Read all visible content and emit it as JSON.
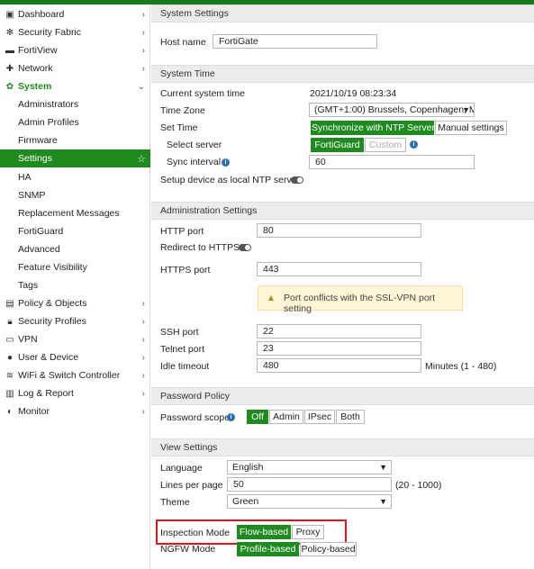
{
  "sidebar": {
    "items": [
      {
        "label": "Dashboard",
        "icon": "dashboard-icon"
      },
      {
        "label": "Security Fabric",
        "icon": "security-fabric-icon"
      },
      {
        "label": "FortiView",
        "icon": "fortiview-icon"
      },
      {
        "label": "Network",
        "icon": "network-icon"
      },
      {
        "label": "System",
        "icon": "gear-icon"
      },
      {
        "label": "Administrators"
      },
      {
        "label": "Admin Profiles"
      },
      {
        "label": "Firmware"
      },
      {
        "label": "Settings"
      },
      {
        "label": "HA"
      },
      {
        "label": "SNMP"
      },
      {
        "label": "Replacement Messages"
      },
      {
        "label": "FortiGuard"
      },
      {
        "label": "Advanced"
      },
      {
        "label": "Feature Visibility"
      },
      {
        "label": "Tags"
      },
      {
        "label": "Policy & Objects",
        "icon": "policy-icon"
      },
      {
        "label": "Security Profiles",
        "icon": "lock-icon"
      },
      {
        "label": "VPN",
        "icon": "vpn-icon"
      },
      {
        "label": "User & Device",
        "icon": "user-icon"
      },
      {
        "label": "WiFi & Switch Controller",
        "icon": "wifi-icon"
      },
      {
        "label": "Log & Report",
        "icon": "chart-icon"
      },
      {
        "label": "Monitor",
        "icon": "monitor-icon"
      }
    ]
  },
  "system_settings": {
    "header": "System Settings",
    "hostname_label": "Host name",
    "hostname_value": "FortiGate"
  },
  "system_time": {
    "header": "System Time",
    "current_label": "Current system time",
    "current_value": "2021/10/19 08:23:34",
    "timezone_label": "Time Zone",
    "timezone_value": "(GMT+1:00) Brussels, Copenhagen, M",
    "settime_label": "Set Time",
    "settime_ntp": "Synchronize with NTP Server",
    "settime_manual": "Manual settings",
    "server_label": "Select server",
    "server_fortiguard": "FortiGuard",
    "server_custom": "Custom",
    "sync_label": "Sync interval",
    "sync_value": "60",
    "ntp_label": "Setup device as local NTP server"
  },
  "admin_settings": {
    "header": "Administration Settings",
    "http_label": "HTTP port",
    "http_value": "80",
    "redirect_label": "Redirect to HTTPS",
    "https_label": "HTTPS port",
    "https_value": "443",
    "warning": "Port conflicts with the SSL-VPN port setting",
    "ssh_label": "SSH port",
    "ssh_value": "22",
    "telnet_label": "Telnet port",
    "telnet_value": "23",
    "idle_label": "Idle timeout",
    "idle_value": "480",
    "idle_hint": "Minutes (1 - 480)"
  },
  "password_policy": {
    "header": "Password Policy",
    "scope_label": "Password scope",
    "options": [
      "Off",
      "Admin",
      "IPsec",
      "Both"
    ]
  },
  "view_settings": {
    "header": "View Settings",
    "language_label": "Language",
    "language_value": "English",
    "lines_label": "Lines per page",
    "lines_value": "50",
    "lines_hint": "(20 - 1000)",
    "theme_label": "Theme",
    "theme_value": "Green",
    "inspection_label": "Inspection Mode",
    "inspection_flow": "Flow-based",
    "inspection_proxy": "Proxy",
    "ngfw_label": "NGFW Mode",
    "ngfw_profile": "Profile-based",
    "ngfw_policy": "Policy-based"
  },
  "colors": {
    "accent": "#1f8a1f",
    "highlight": "#e0141e",
    "warning_bg": "#fff4d6"
  }
}
